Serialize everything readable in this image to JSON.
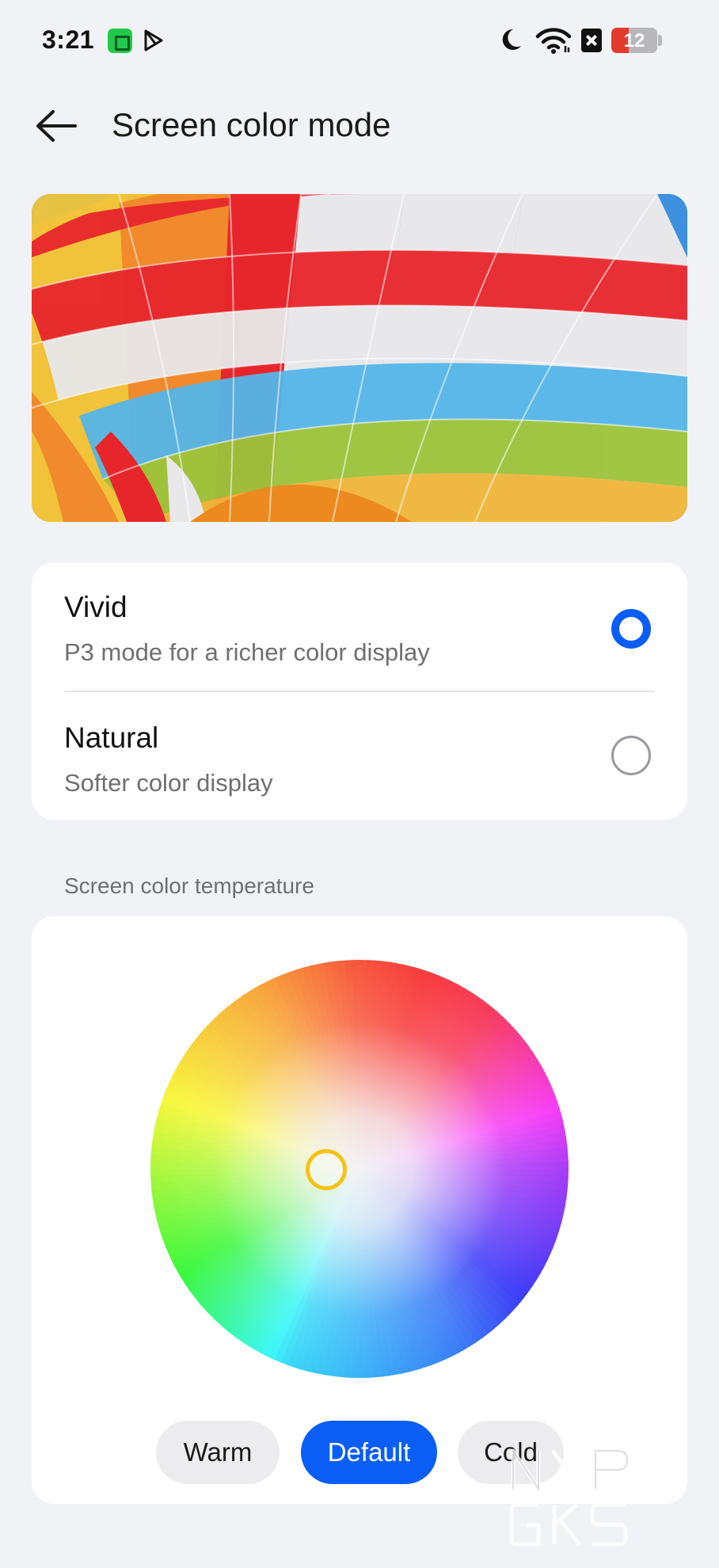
{
  "status_bar": {
    "time": "3:21",
    "battery_level": "12",
    "battery_fraction": 0.12,
    "icons": [
      "app-icon",
      "play-icon",
      "moon-icon",
      "wifi-icon",
      "x-icon",
      "battery-icon"
    ]
  },
  "header": {
    "title": "Screen color mode",
    "back_icon": "arrow-left-icon"
  },
  "preview": {
    "image": "hot-air-balloon-photo"
  },
  "color_modes": [
    {
      "label": "Vivid",
      "description": "P3 mode for a richer color display",
      "selected": true
    },
    {
      "label": "Natural",
      "description": "Softer color display",
      "selected": false
    }
  ],
  "temperature": {
    "section_label": "Screen color temperature",
    "presets": [
      "Warm",
      "Default",
      "Cold"
    ],
    "selected_preset": "Default"
  },
  "watermark": {
    "text": "NYP GKS"
  },
  "colors": {
    "accent": "#0a5ef5",
    "background": "#f1f2f6",
    "card": "#ffffff",
    "handle": "#f5c318"
  }
}
